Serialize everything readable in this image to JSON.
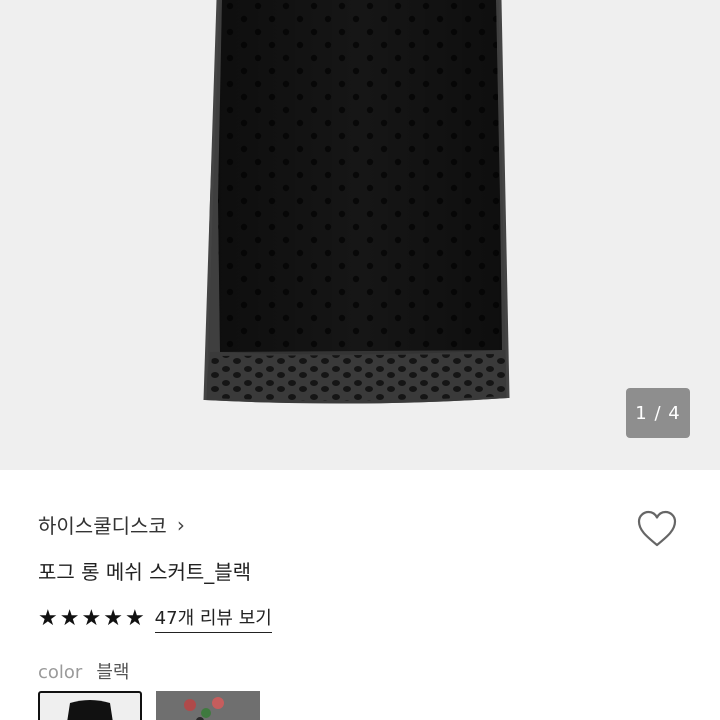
{
  "gallery": {
    "counter": "1 / 4",
    "image_description_icon": "skirt-image"
  },
  "product": {
    "brand": "하이스쿨디스코",
    "brand_chevron": "›",
    "title": "포그 롱 메쉬 스커트_블랙",
    "rating": 5,
    "stars": [
      "★",
      "★",
      "★",
      "★",
      "★"
    ],
    "review_link": "47개 리뷰 보기",
    "color_label": "color",
    "color_value": "블랙",
    "swatches": [
      "black-swatch",
      "pattern-swatch"
    ],
    "wishlist_icon": "heart-icon"
  }
}
